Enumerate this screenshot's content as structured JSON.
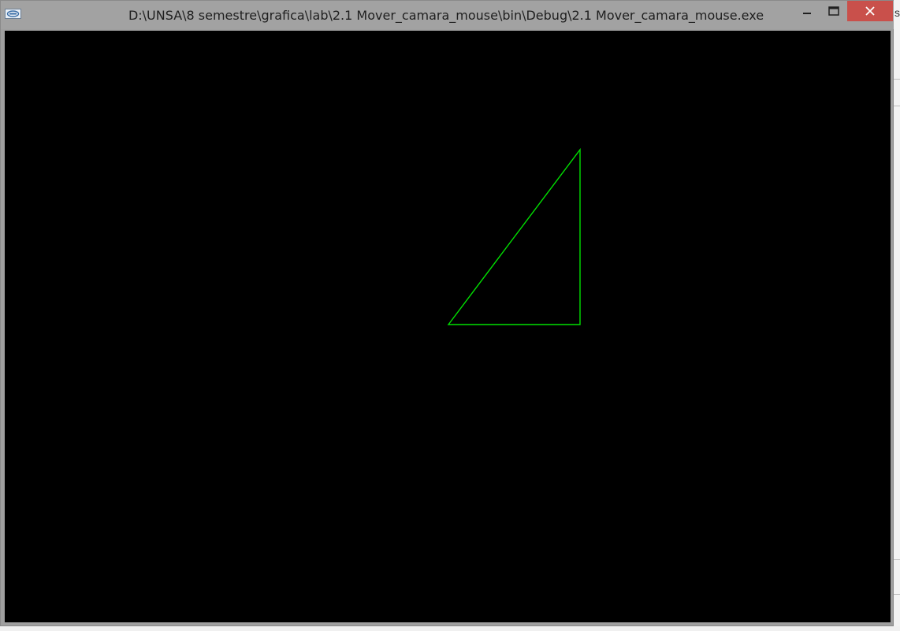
{
  "window": {
    "title": "D:\\UNSA\\8 semestre\\grafica\\lab\\2.1 Mover_camara_mouse\\bin\\Debug\\2.1 Mover_camara_mouse.exe",
    "icon": "application-icon",
    "controls": {
      "minimize_icon": "minimize-icon",
      "maximize_icon": "maximize-icon",
      "close_icon": "close-icon",
      "close_color": "#c9504b"
    }
  },
  "viewport": {
    "background": "#000000",
    "shape": {
      "type": "triangle-outline",
      "color": "#00e000"
    }
  },
  "background_fragment": {
    "text": "s"
  }
}
